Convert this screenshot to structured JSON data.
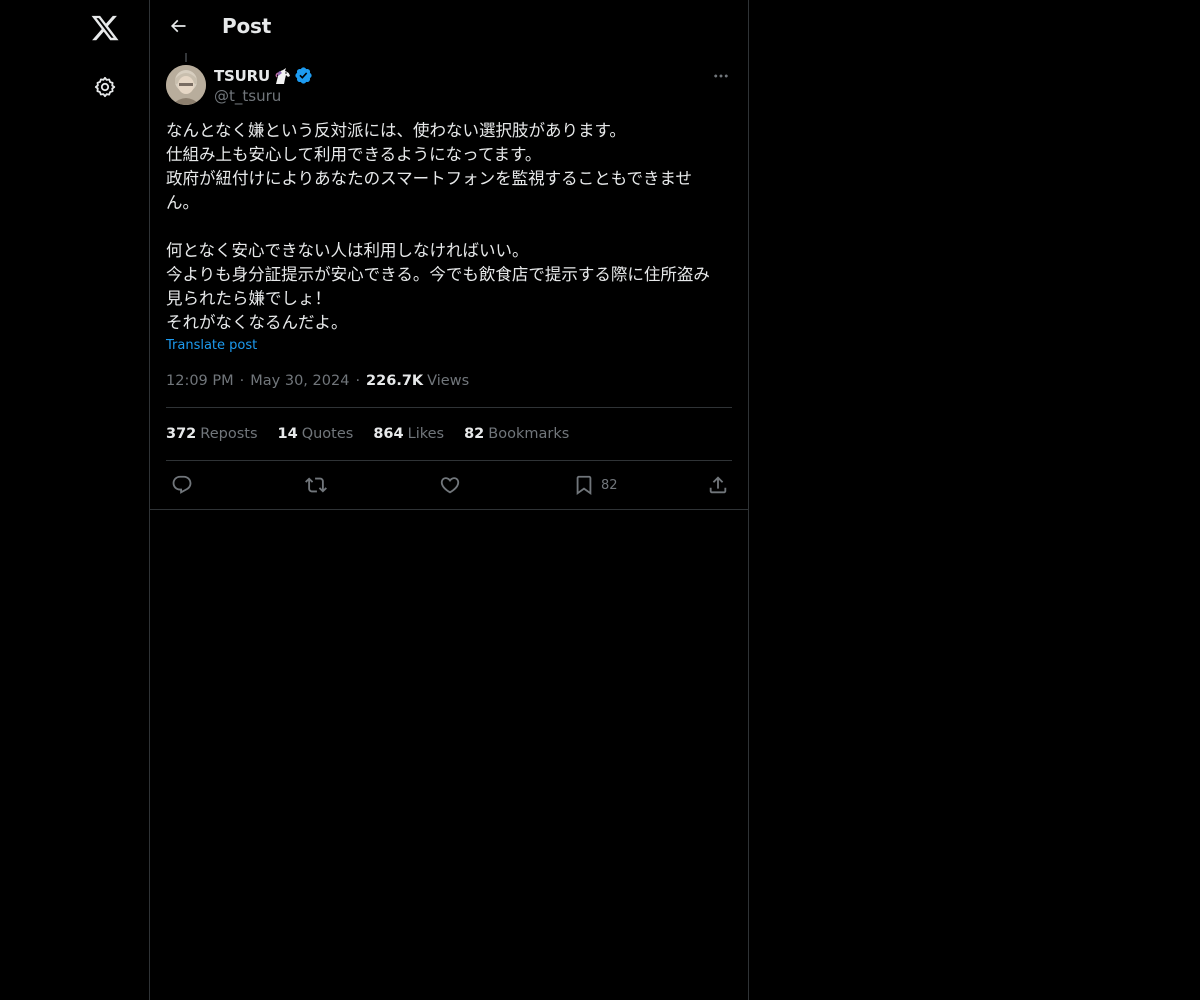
{
  "header": {
    "title": "Post"
  },
  "post": {
    "author": {
      "name": "TSURU",
      "handle": "@t_tsuru"
    },
    "body_lines": [
      "なんとなく嫌という反対派には、使わない選択肢があります。",
      "仕組み上も安心して利用できるようになってます。",
      "政府が紐付けによりあなたのスマートフォンを監視することもできませ",
      "ん。",
      "",
      "何となく安心できない人は利用しなければいい。",
      "今よりも身分証提示が安心できる。今でも飲食店で提示する際に住所盗み",
      "見られたら嫌でしょ！",
      "それがなくなるんだよ。"
    ],
    "translate_label": "Translate post",
    "time": "12:09 PM",
    "date": "May 30, 2024",
    "separator": "·",
    "views_count": "226.7K",
    "views_label": "Views",
    "stats": {
      "reposts": {
        "count": "372",
        "label": "Reposts"
      },
      "quotes": {
        "count": "14",
        "label": "Quotes"
      },
      "likes": {
        "count": "864",
        "label": "Likes"
      },
      "bookmarks": {
        "count": "82",
        "label": "Bookmarks"
      }
    },
    "actions": {
      "bookmark_count": "82"
    }
  },
  "icons": {
    "logo": "x-logo-icon",
    "settings": "gear-icon",
    "back": "arrow-left-icon",
    "more": "more-horizontal-icon",
    "verified": "verified-badge-icon",
    "emoji": "unicorn-emoji-icon",
    "reply": "reply-icon",
    "repost": "repost-icon",
    "like": "heart-icon",
    "bookmark": "bookmark-icon",
    "share": "share-icon"
  },
  "colors": {
    "background": "#000000",
    "text_primary": "#e7e9ea",
    "text_secondary": "#71767b",
    "accent": "#1d9bf0",
    "border": "#2f3336"
  }
}
